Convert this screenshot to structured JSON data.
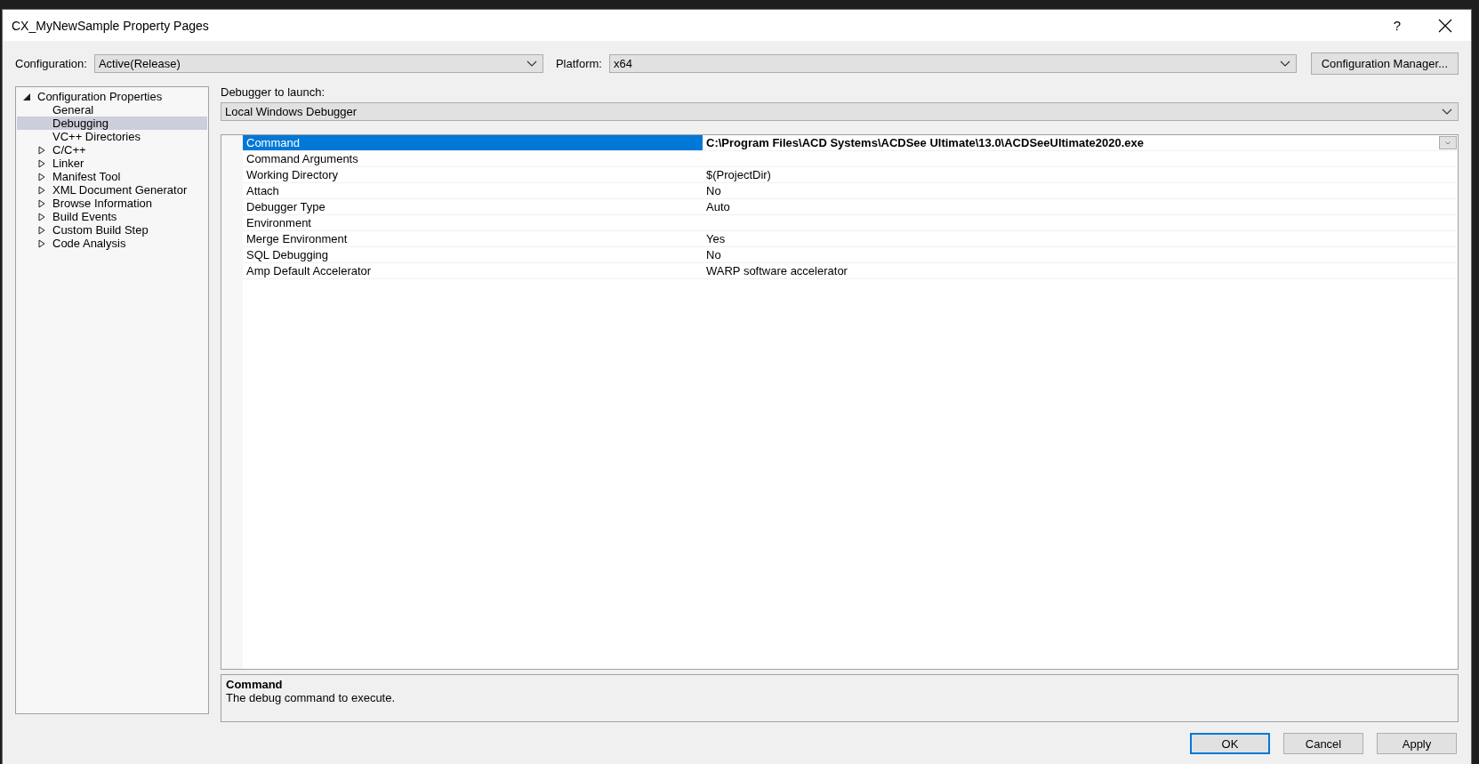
{
  "window": {
    "title": "CX_MyNewSample Property Pages",
    "help": "?"
  },
  "configuration": {
    "label": "Configuration:",
    "value": "Active(Release)"
  },
  "platform": {
    "label": "Platform:",
    "value": "x64"
  },
  "configuration_manager_button": "Configuration Manager...",
  "tree": [
    {
      "label": "Configuration Properties",
      "kind": "folder",
      "expanded": true,
      "selected": false,
      "children": [
        {
          "label": "General",
          "kind": "leaf",
          "selected": false
        },
        {
          "label": "Debugging",
          "kind": "leaf",
          "selected": true
        },
        {
          "label": "VC++ Directories",
          "kind": "leaf",
          "selected": false
        },
        {
          "label": "C/C++",
          "kind": "folder",
          "expanded": false,
          "selected": false
        },
        {
          "label": "Linker",
          "kind": "folder",
          "expanded": false,
          "selected": false
        },
        {
          "label": "Manifest Tool",
          "kind": "folder",
          "expanded": false,
          "selected": false
        },
        {
          "label": "XML Document Generator",
          "kind": "folder",
          "expanded": false,
          "selected": false
        },
        {
          "label": "Browse Information",
          "kind": "folder",
          "expanded": false,
          "selected": false
        },
        {
          "label": "Build Events",
          "kind": "folder",
          "expanded": false,
          "selected": false
        },
        {
          "label": "Custom Build Step",
          "kind": "folder",
          "expanded": false,
          "selected": false
        },
        {
          "label": "Code Analysis",
          "kind": "folder",
          "expanded": false,
          "selected": false
        }
      ]
    }
  ],
  "debugger": {
    "label": "Debugger to launch:",
    "value": "Local Windows Debugger"
  },
  "properties": [
    {
      "name": "Command",
      "value": "C:\\Program Files\\ACD Systems\\ACDSee Ultimate\\13.0\\ACDSeeUltimate2020.exe",
      "selected": true,
      "modified": true
    },
    {
      "name": "Command Arguments",
      "selected": false
    },
    {
      "name": "Working Directory",
      "value": "$(ProjectDir)",
      "selected": false,
      "modified": false
    },
    {
      "name": "Attach",
      "value": "No",
      "selected": false,
      "modified": false
    },
    {
      "name": "Debugger Type",
      "value": "Auto",
      "selected": false,
      "modified": false
    },
    {
      "name": "Environment",
      "selected": false
    },
    {
      "name": "Merge Environment",
      "value": "Yes",
      "selected": false,
      "modified": false
    },
    {
      "name": "SQL Debugging",
      "value": "No",
      "selected": false,
      "modified": false
    },
    {
      "name": "Amp Default Accelerator",
      "value": "WARP software accelerator",
      "selected": false,
      "modified": false
    }
  ],
  "description": {
    "title": "Command",
    "text": "The debug command to execute."
  },
  "buttons": [
    {
      "label": "OK",
      "default": true
    },
    {
      "label": "Cancel",
      "default": false
    },
    {
      "label": "Apply",
      "default": false
    }
  ]
}
